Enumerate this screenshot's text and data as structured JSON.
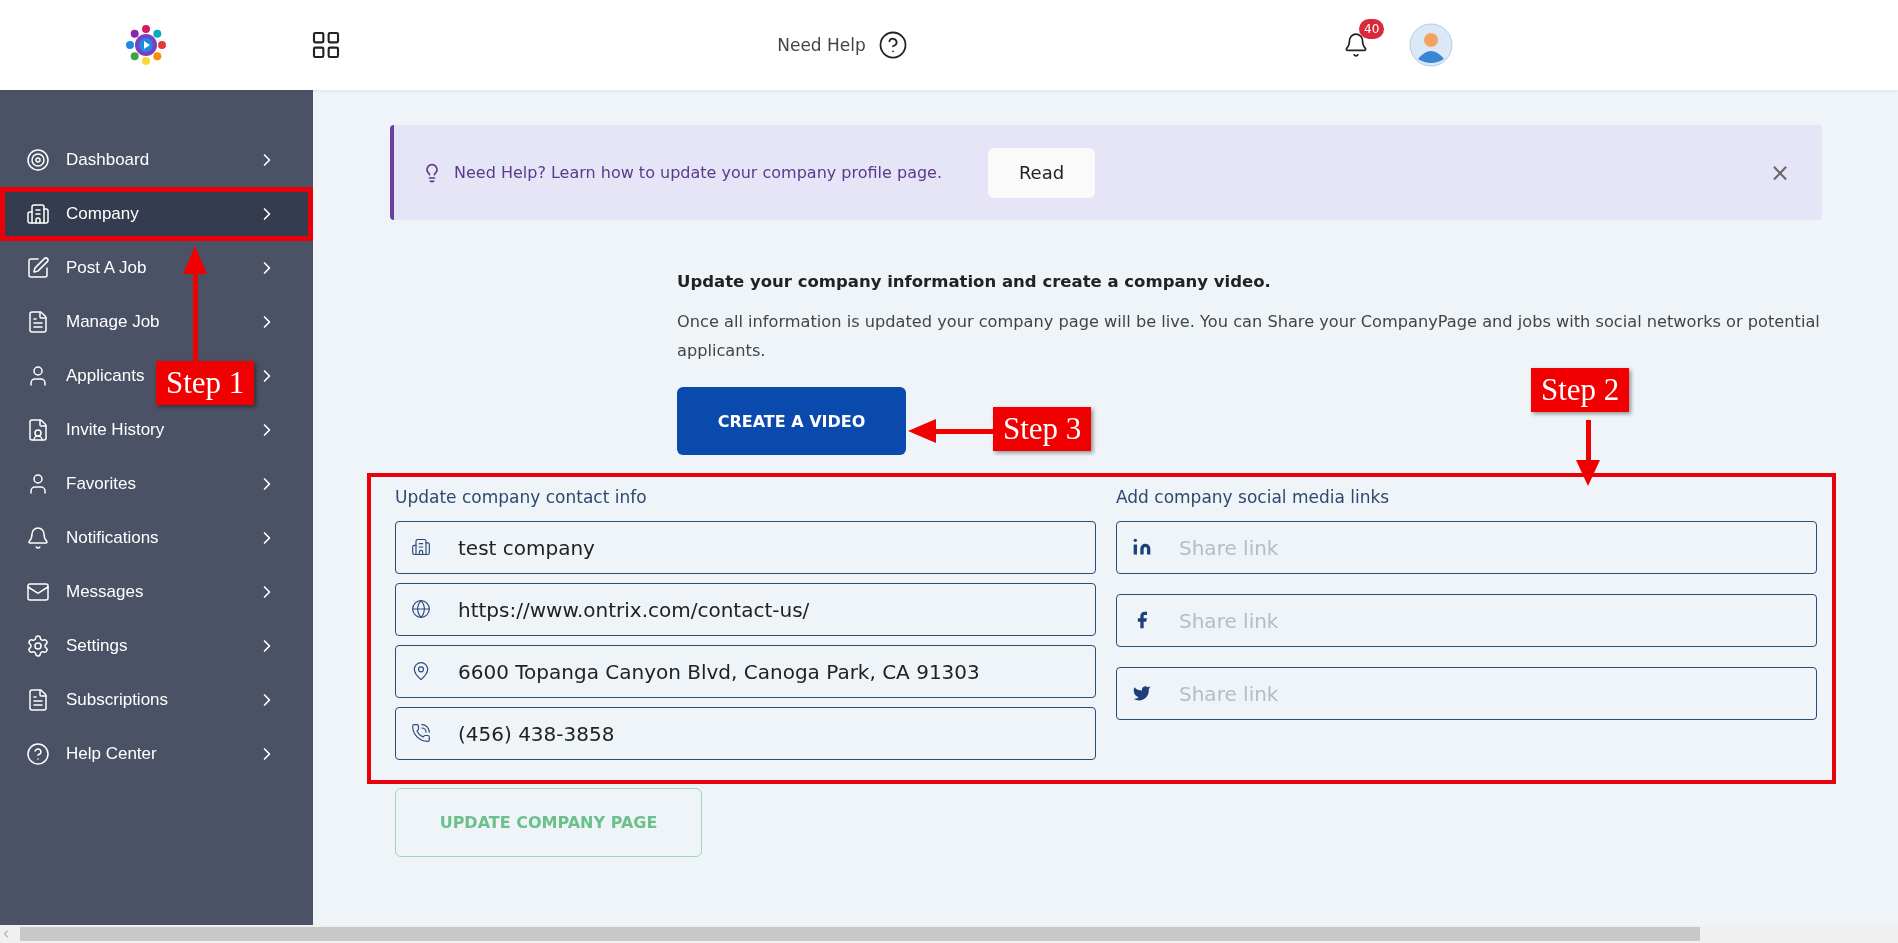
{
  "header": {
    "help_label": "Need Help",
    "notification_count": "40"
  },
  "sidebar": {
    "items": [
      {
        "label": "Dashboard",
        "selected": false,
        "highlighted": false
      },
      {
        "label": "Company",
        "selected": true,
        "highlighted": true
      },
      {
        "label": "Post A Job",
        "selected": false,
        "highlighted": false
      },
      {
        "label": "Manage Job",
        "selected": false,
        "highlighted": false
      },
      {
        "label": "Applicants",
        "selected": false,
        "highlighted": false
      },
      {
        "label": "Invite History",
        "selected": false,
        "highlighted": false
      },
      {
        "label": "Favorites",
        "selected": false,
        "highlighted": false
      },
      {
        "label": "Notifications",
        "selected": false,
        "highlighted": false
      },
      {
        "label": "Messages",
        "selected": false,
        "highlighted": false
      },
      {
        "label": "Settings",
        "selected": false,
        "highlighted": false
      },
      {
        "label": "Subscriptions",
        "selected": false,
        "highlighted": false
      },
      {
        "label": "Help Center",
        "selected": false,
        "highlighted": false
      }
    ]
  },
  "help_banner": {
    "text": "Need Help? Learn how to update your company profile page.",
    "button": "Read",
    "close": "×"
  },
  "intro": {
    "title": "Update your company information and create a company video.",
    "text": "Once all information is updated your company page will be live. You can Share your CompanyPage and jobs with social networks or potential applicants."
  },
  "create_button": "CREATE A VIDEO",
  "contact_form": {
    "highlighted": true,
    "contact_title": "Update company contact info",
    "contact_fields": [
      {
        "value": "test company"
      },
      {
        "value": "https://www.ontrix.com/contact-us/"
      },
      {
        "value": "6600 Topanga Canyon Blvd, Canoga Park, CA 91303"
      },
      {
        "value": "(456) 438-3858"
      }
    ],
    "social_title": "Add company social media links",
    "social_fields": [
      {
        "placeholder": "Share link"
      },
      {
        "placeholder": "Share link"
      },
      {
        "placeholder": "Share link"
      }
    ]
  },
  "update_button": {
    "label": "UPDATE COMPANY PAGE",
    "disabled": true
  },
  "annotations": [
    {
      "label": "Step 1"
    },
    {
      "label": "Step 2"
    },
    {
      "label": "Step 3"
    }
  ]
}
